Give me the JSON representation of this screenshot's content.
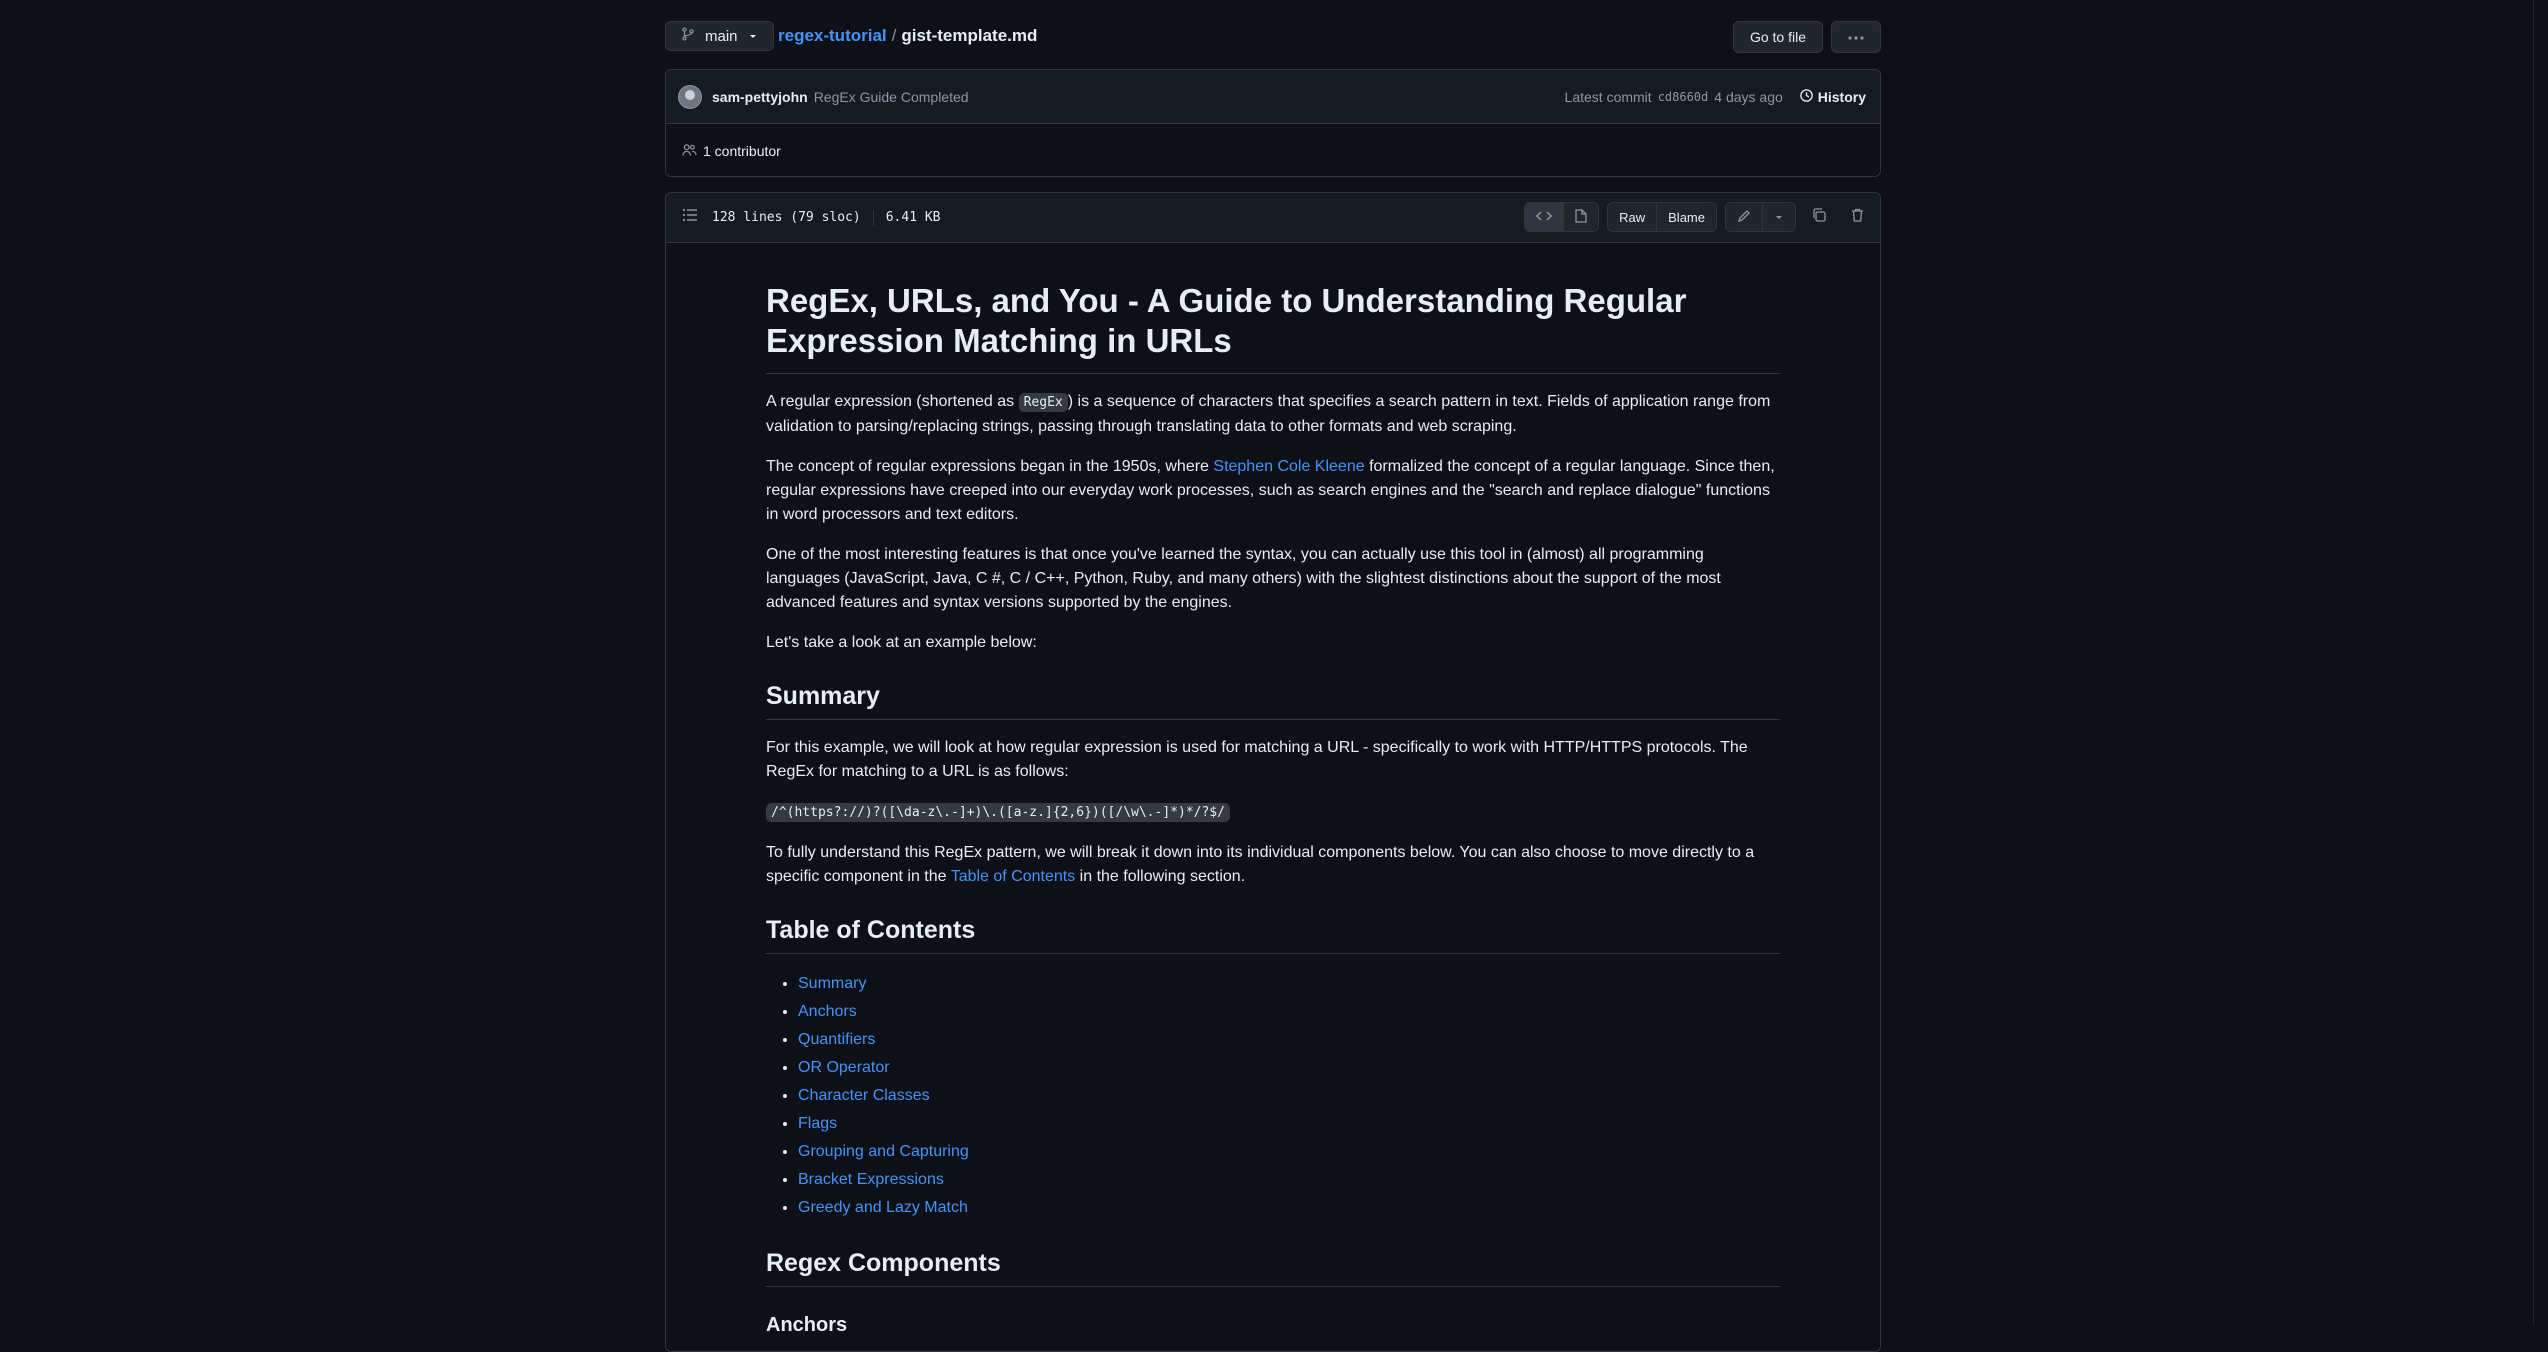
{
  "header": {
    "branch": "main",
    "repo": "regex-tutorial",
    "separator": "/",
    "file": "gist-template.md",
    "go_to_file": "Go to file"
  },
  "commit": {
    "author": "sam-pettyjohn",
    "message": "RegEx Guide Completed",
    "latest_label": "Latest commit",
    "sha": "cd8660d",
    "age": "4 days ago",
    "history": "History",
    "contributors": "1 contributor"
  },
  "file": {
    "lines": "128 lines (79 sloc)",
    "size": "6.41 KB",
    "raw": "Raw",
    "blame": "Blame"
  },
  "content": {
    "title": "RegEx, URLs, and You - A Guide to Understanding Regular Expression Matching in URLs",
    "p1_a": "A regular expression (shortened as ",
    "p1_code": "RegEx",
    "p1_b": ") is a sequence of characters that specifies a search pattern in text. Fields of application range from validation to parsing/replacing strings, passing through translating data to other formats and web scraping.",
    "p2_a": "The concept of regular expressions began in the 1950s, where ",
    "p2_link": "Stephen Cole Kleene",
    "p2_b": " formalized the concept of a regular language. Since then, regular expressions have creeped into our everyday work processes, such as search engines and the \"search and replace dialogue\" functions in word processors and text editors.",
    "p3": "One of the most interesting features is that once you've learned the syntax, you can actually use this tool in (almost) all programming languages (JavaScript, Java, C #, C / C++, Python, Ruby, and many others) with the slightest distinctions about the support of the most advanced features and syntax versions supported by the engines.",
    "p4": "Let's take a look at an example below:",
    "h_summary": "Summary",
    "p5": "For this example, we will look at how regular expression is used for matching a URL - specifically to work with HTTP/HTTPS protocols. The RegEx for matching to a URL is as follows:",
    "regex": "/^(https?://)?([\\da-z\\.-]+)\\.([a-z.]{2,6})([/\\w\\.-]*)*/?$/",
    "p6_a": "To fully understand this RegEx pattern, we will break it down into its individual components below. You can also choose to move directly to a specific component in the ",
    "p6_link": "Table of Contents",
    "p6_b": " in the following section.",
    "h_toc": "Table of Contents",
    "toc": [
      "Summary",
      "Anchors",
      "Quantifiers",
      "OR Operator",
      "Character Classes",
      "Flags",
      "Grouping and Capturing",
      "Bracket Expressions",
      "Greedy and Lazy Match"
    ],
    "h_components": "Regex Components",
    "h_anchors": "Anchors"
  }
}
